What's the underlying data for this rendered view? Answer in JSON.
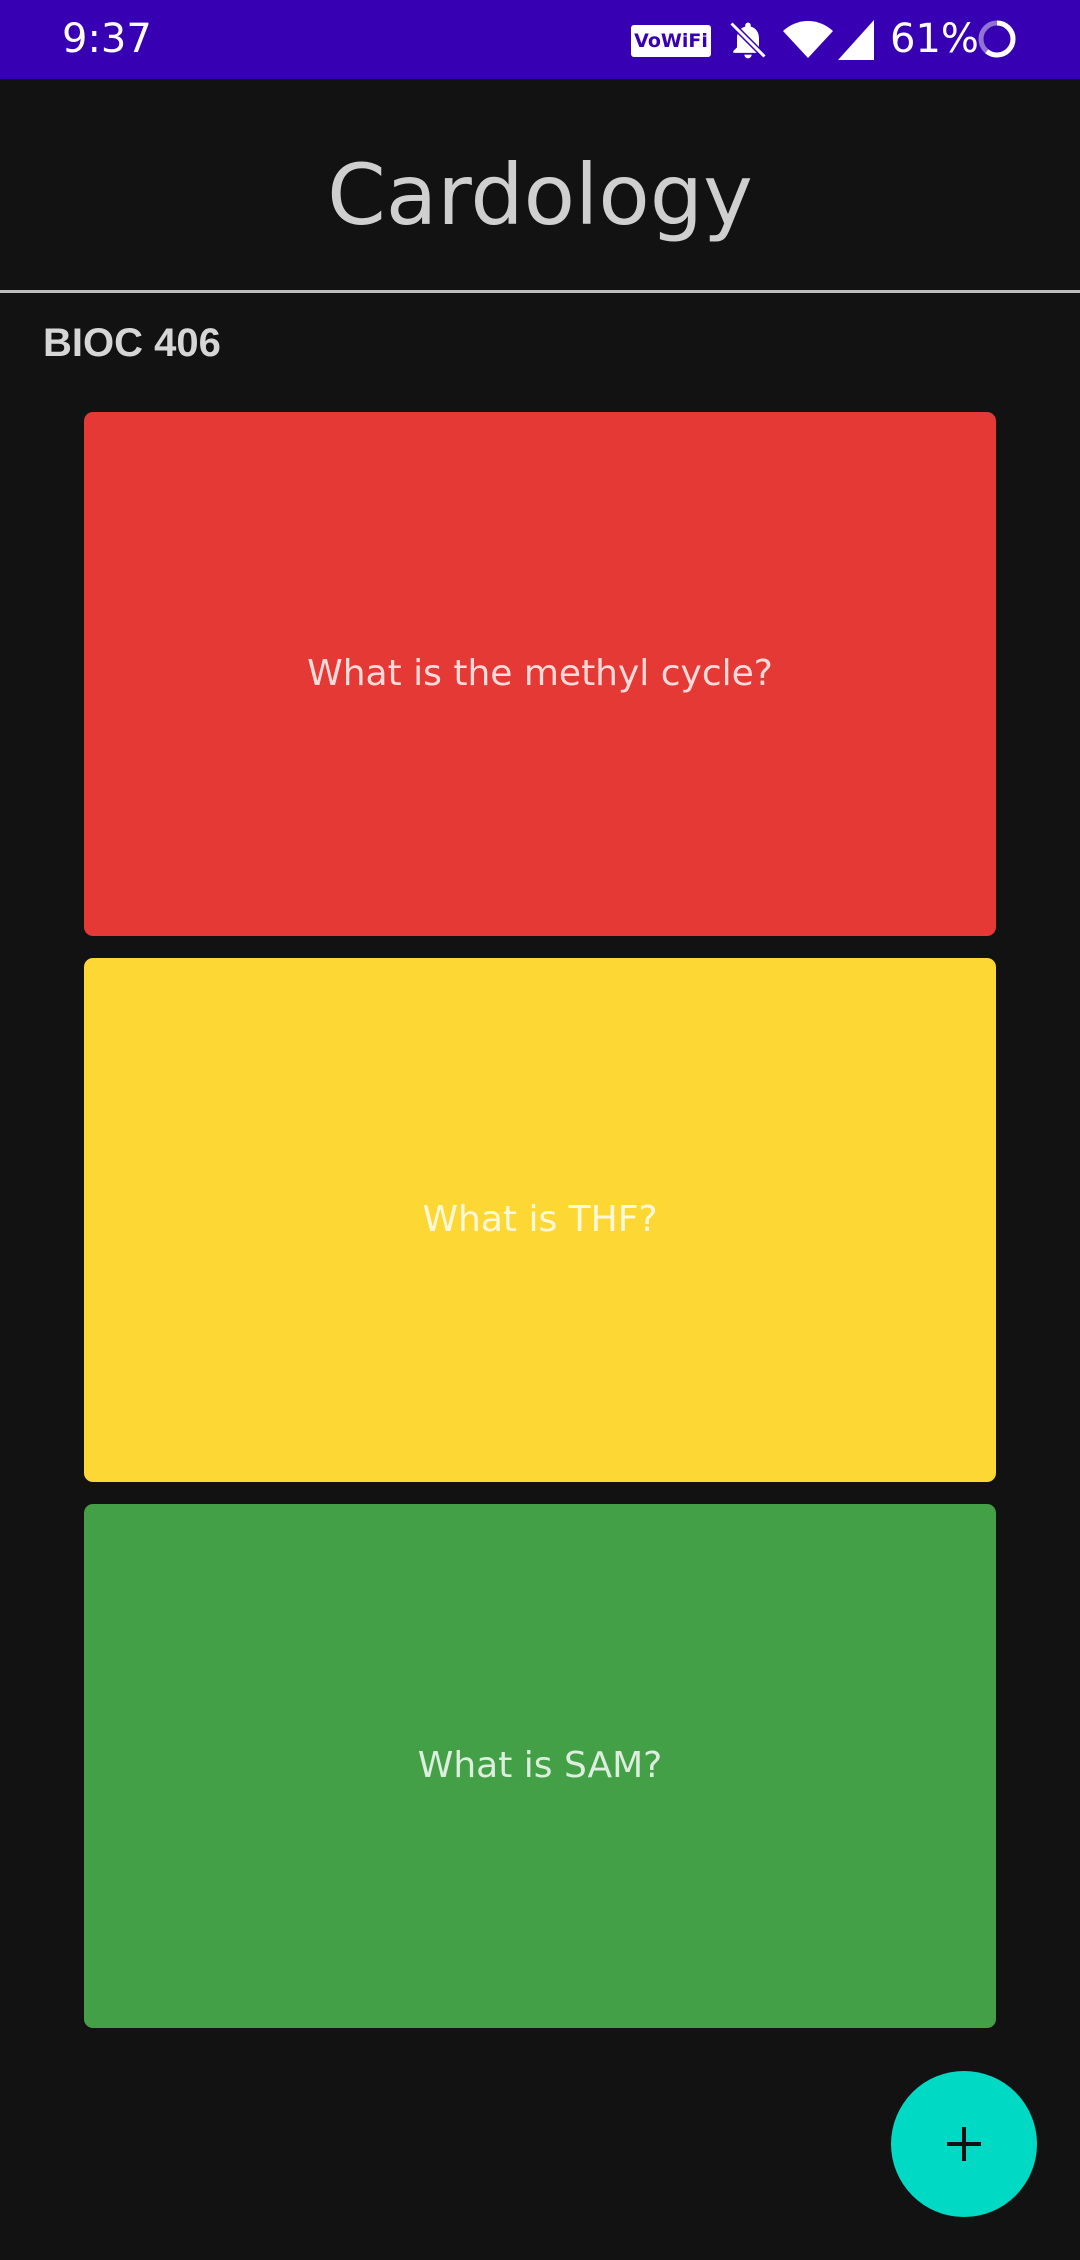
{
  "status_bar": {
    "time": "9:37",
    "vowifi_label": "VoWiFi",
    "battery_percent": "61%",
    "background_color": "#3700b3",
    "icons": [
      "vowifi-badge",
      "bell-off-icon",
      "wifi-icon",
      "cell-signal-icon",
      "battery-ring-icon"
    ]
  },
  "app_bar": {
    "title": "Cardology"
  },
  "deck": {
    "name": "BIOC 406",
    "cards": [
      {
        "question": "What is the methyl cycle?",
        "color": "#e53935"
      },
      {
        "question": "What is THF?",
        "color": "#fdd835"
      },
      {
        "question": "What is SAM?",
        "color": "#43a047"
      }
    ]
  },
  "fab": {
    "icon": "plus-icon",
    "color": "#00dac5"
  },
  "theme": {
    "background": "#121212"
  }
}
